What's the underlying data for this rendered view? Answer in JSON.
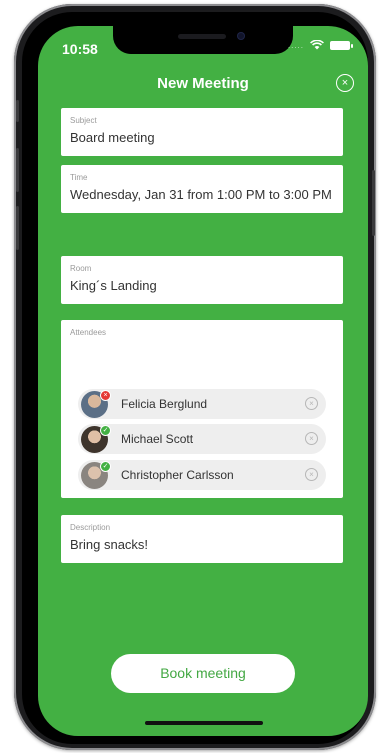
{
  "status": {
    "time": "10:58",
    "signal_dots": "....."
  },
  "header": {
    "title": "New Meeting",
    "close_glyph": "×"
  },
  "form": {
    "subject": {
      "label": "Subject",
      "value": "Board meeting"
    },
    "time": {
      "label": "Time",
      "value": "Wednesday, Jan 31 from 1:00 PM to 3:00 PM"
    },
    "room": {
      "label": "Room",
      "value": "King´s Landing"
    },
    "attendees": {
      "label": "Attendees",
      "items": [
        {
          "name": "Felicia Berglund",
          "status": "declined",
          "status_glyph": "×",
          "status_color": "#e53935",
          "avatar_color": "#7a8fa6"
        },
        {
          "name": "Michael Scott",
          "status": "accepted",
          "status_glyph": "✓",
          "status_color": "#43b043",
          "avatar_color": "#5c4a3d"
        },
        {
          "name": "Christopher Carlsson",
          "status": "accepted",
          "status_glyph": "✓",
          "status_color": "#43b043",
          "avatar_color": "#9a8f86"
        }
      ],
      "remove_glyph": "×"
    },
    "description": {
      "label": "Description",
      "value": "Bring snacks!"
    }
  },
  "actions": {
    "book_label": "Book meeting"
  },
  "colors": {
    "accent": "#43b043",
    "card": "#ffffff",
    "label_gray": "#9a9a9a"
  }
}
